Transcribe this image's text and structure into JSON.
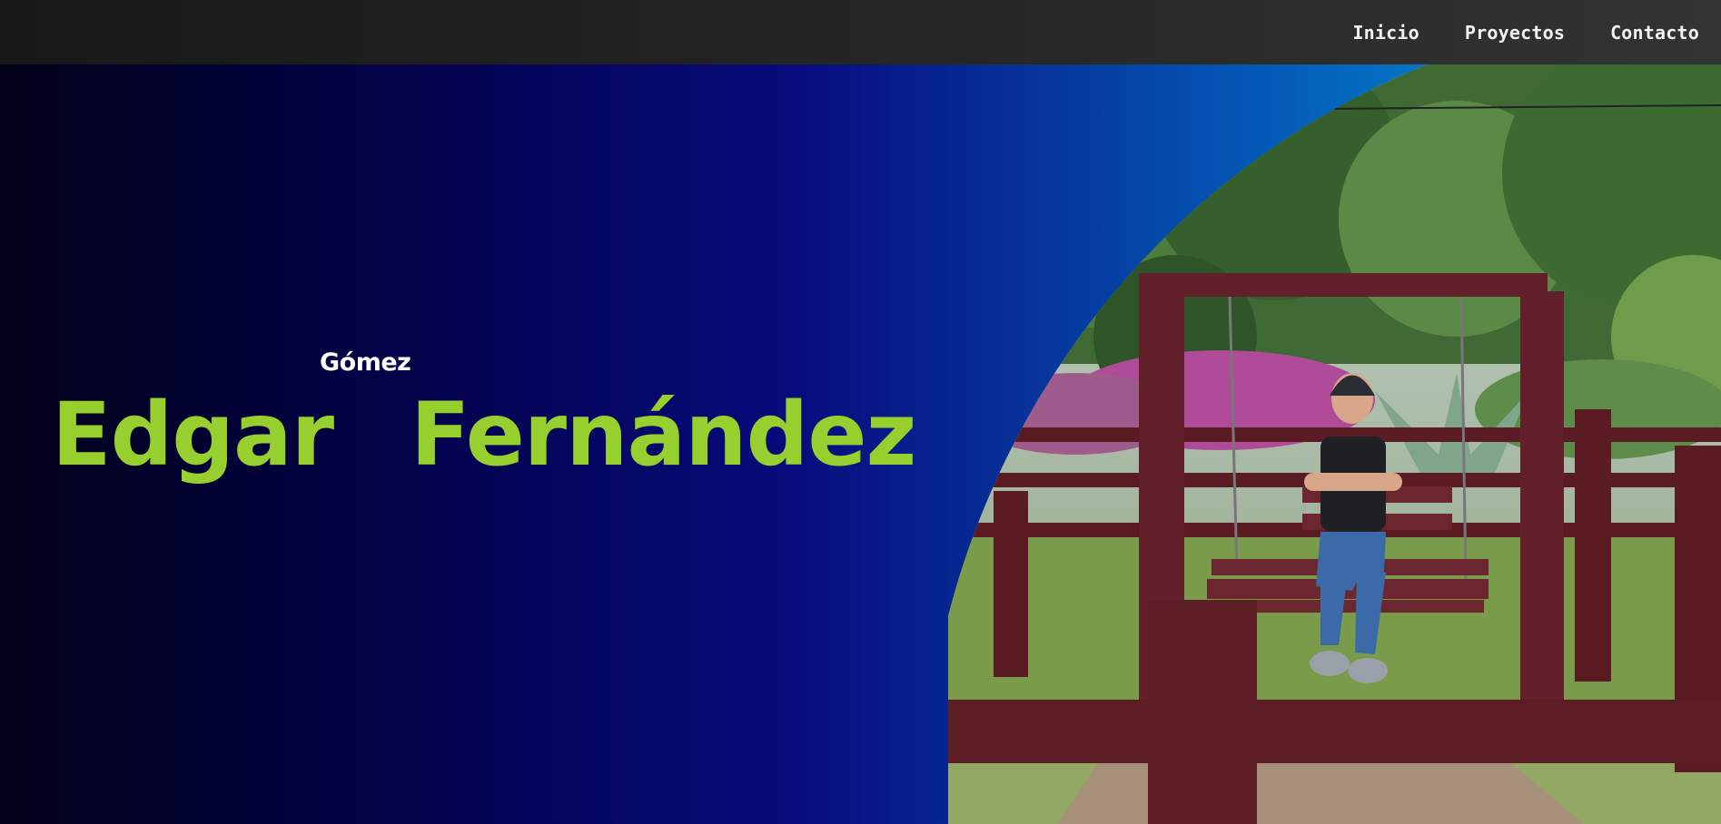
{
  "nav": {
    "items": [
      {
        "label": "Inicio"
      },
      {
        "label": "Proyectos"
      },
      {
        "label": "Contacto"
      }
    ]
  },
  "hero": {
    "first_name": "Edgar",
    "last_name": "Fernández",
    "second_last_name": "Gómez",
    "photo_alt": "Foto de perfil en columpio de madera en un jardín"
  },
  "colors": {
    "accent": "#97d02e",
    "nav_bg": "#262626",
    "gradient_start": "#010118",
    "gradient_mid": "#080b7c",
    "gradient_end": "#03a4e4"
  }
}
